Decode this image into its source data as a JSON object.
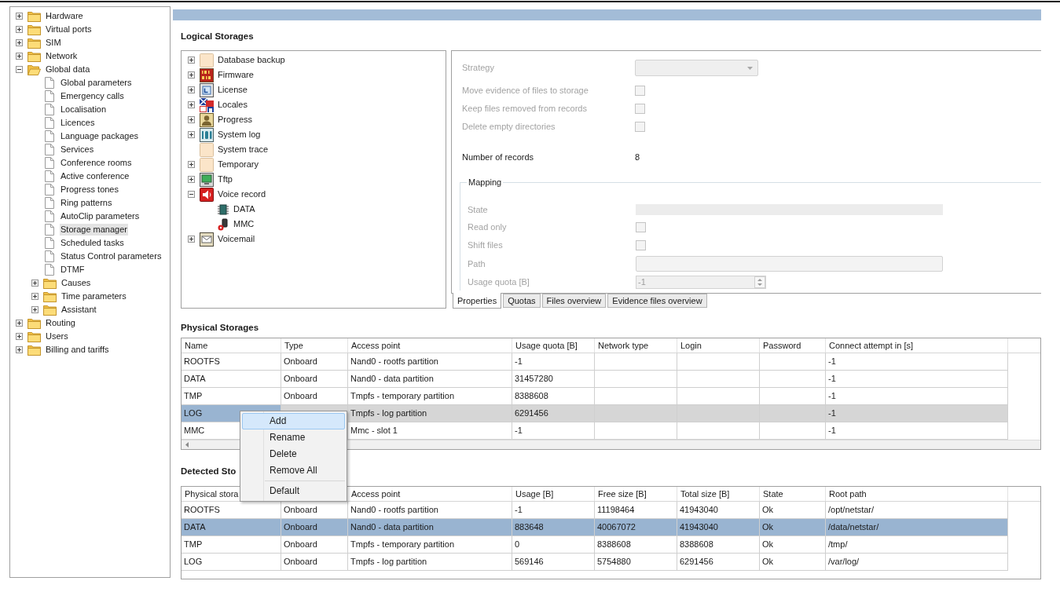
{
  "navigation_tree": {
    "items": [
      {
        "label": "Hardware",
        "kind": "folder",
        "expanded": false,
        "selected": false
      },
      {
        "label": "Virtual ports",
        "kind": "folder",
        "expanded": false,
        "selected": false
      },
      {
        "label": "SIM",
        "kind": "folder",
        "expanded": false,
        "selected": false
      },
      {
        "label": "Network",
        "kind": "folder",
        "expanded": false,
        "selected": false
      },
      {
        "label": "Global data",
        "kind": "folder",
        "expanded": true,
        "selected": false,
        "children": [
          {
            "label": "Global parameters",
            "kind": "page",
            "selected": false
          },
          {
            "label": "Emergency calls",
            "kind": "page",
            "selected": false
          },
          {
            "label": "Localisation",
            "kind": "page",
            "selected": false
          },
          {
            "label": "Licences",
            "kind": "page",
            "selected": false
          },
          {
            "label": "Language packages",
            "kind": "page",
            "selected": false
          },
          {
            "label": "Services",
            "kind": "page",
            "selected": false
          },
          {
            "label": "Conference rooms",
            "kind": "page",
            "selected": false
          },
          {
            "label": "Active conference",
            "kind": "page",
            "selected": false
          },
          {
            "label": "Progress tones",
            "kind": "page",
            "selected": false
          },
          {
            "label": "Ring patterns",
            "kind": "page",
            "selected": false
          },
          {
            "label": "AutoClip parameters",
            "kind": "page",
            "selected": false
          },
          {
            "label": "Storage manager",
            "kind": "page",
            "selected": true
          },
          {
            "label": "Scheduled tasks",
            "kind": "page",
            "selected": false
          },
          {
            "label": "Status Control parameters",
            "kind": "page",
            "selected": false
          },
          {
            "label": "DTMF",
            "kind": "page",
            "selected": false
          },
          {
            "label": "Causes",
            "kind": "folder",
            "expanded": false,
            "selected": false
          },
          {
            "label": "Time parameters",
            "kind": "folder",
            "expanded": false,
            "selected": false
          },
          {
            "label": "Assistant",
            "kind": "folder",
            "expanded": false,
            "selected": false
          }
        ]
      },
      {
        "label": "Routing",
        "kind": "folder",
        "expanded": false,
        "selected": false
      },
      {
        "label": "Users",
        "kind": "folder",
        "expanded": false,
        "selected": false
      },
      {
        "label": "Billing and tariffs",
        "kind": "folder",
        "expanded": false,
        "selected": false
      }
    ]
  },
  "logical_storages": {
    "title": "Logical Storages",
    "tree": [
      {
        "label": "Database backup",
        "kind": "blank",
        "expanded": false
      },
      {
        "label": "Firmware",
        "kind": "binary",
        "expanded": false
      },
      {
        "label": "License",
        "kind": "certificate",
        "expanded": false
      },
      {
        "label": "Locales",
        "kind": "flags",
        "expanded": false
      },
      {
        "label": "Progress",
        "kind": "person",
        "expanded": false
      },
      {
        "label": "System log",
        "kind": "log",
        "expanded": false
      },
      {
        "label": "System trace",
        "kind": "blank"
      },
      {
        "label": "Temporary",
        "kind": "blank",
        "expanded": false
      },
      {
        "label": "Tftp",
        "kind": "monitor",
        "expanded": false
      },
      {
        "label": "Voice record",
        "kind": "speaker",
        "expanded": true,
        "children": [
          {
            "label": "DATA",
            "kind": "chip"
          },
          {
            "label": "MMC",
            "kind": "card"
          }
        ]
      },
      {
        "label": "Voicemail",
        "kind": "envelope",
        "expanded": false
      }
    ]
  },
  "properties_panel": {
    "fields": [
      {
        "kind": "dropdown",
        "label": "Strategy",
        "disabled": true
      },
      {
        "kind": "checkbox",
        "label": "Move evidence of files to storage",
        "checked": false,
        "disabled": true
      },
      {
        "kind": "checkbox",
        "label": "Keep files removed from records",
        "checked": false,
        "disabled": true
      },
      {
        "kind": "checkbox",
        "label": "Delete empty directories",
        "checked": false,
        "disabled": true
      },
      {
        "kind": "value",
        "label": "Number of records",
        "value": "8",
        "disabled": false
      }
    ],
    "mapping": {
      "title": "Mapping",
      "fields": [
        {
          "kind": "display",
          "label": "State",
          "disabled": true
        },
        {
          "kind": "checkbox",
          "label": "Read only",
          "checked": false,
          "disabled": true
        },
        {
          "kind": "checkbox",
          "label": "Shift files",
          "checked": false,
          "disabled": true
        },
        {
          "kind": "text",
          "label": "Path",
          "disabled": true
        },
        {
          "kind": "spinner",
          "label": "Usage quota [B]",
          "value": "-1",
          "disabled": true
        }
      ]
    },
    "tabs": [
      {
        "label": "Properties",
        "selected": true
      },
      {
        "label": "Quotas",
        "selected": false
      },
      {
        "label": "Files overview",
        "selected": false
      },
      {
        "label": "Evidence files overview",
        "selected": false
      }
    ]
  },
  "physical_storages": {
    "title": "Physical Storages",
    "full_row_highlight": false,
    "columns": {
      "name": "Name",
      "type": "Type",
      "access_point": "Access point",
      "usage_quota": "Usage quota [B]",
      "network_type": "Network type",
      "login": "Login",
      "password": "Password",
      "connect_attempt": "Connect attempt in [s]"
    },
    "rows": [
      {
        "name": "ROOTFS",
        "type": "Onboard",
        "access_point": "Nand0 - rootfs partition",
        "usage_quota": "-1",
        "connect_attempt": "-1",
        "selected": false
      },
      {
        "name": "DATA",
        "type": "Onboard",
        "access_point": "Nand0 - data partition",
        "usage_quota": "31457280",
        "connect_attempt": "-1",
        "selected": false
      },
      {
        "name": "TMP",
        "type": "Onboard",
        "access_point": "Tmpfs - temporary partition",
        "usage_quota": "8388608",
        "connect_attempt": "-1",
        "selected": false
      },
      {
        "name": "LOG",
        "access_point": "Tmpfs - log partition",
        "usage_quota": "6291456",
        "connect_attempt": "-1",
        "selected": true
      },
      {
        "name": "MMC",
        "access_point": "Mmc - slot 1",
        "usage_quota": "-1",
        "connect_attempt": "-1",
        "selected": false
      }
    ]
  },
  "context_menu": {
    "items": [
      {
        "kind": "item",
        "label": "Add",
        "selected": true
      },
      {
        "kind": "item",
        "label": "Rename",
        "selected": false
      },
      {
        "kind": "item",
        "label": "Delete",
        "selected": false
      },
      {
        "kind": "item",
        "label": "Remove All",
        "selected": false
      },
      {
        "kind": "separator"
      },
      {
        "kind": "item",
        "label": "Default",
        "selected": false
      }
    ]
  },
  "detected_storages": {
    "title": "Detected Sto",
    "full_row_highlight": true,
    "columns": {
      "physical_storage": "Physical stora",
      "access_point": "Access point",
      "usage": "Usage [B]",
      "free_size": "Free size [B]",
      "total_size": "Total size [B]",
      "state": "State",
      "root_path": "Root path"
    },
    "rows": [
      {
        "physical_storage": "ROOTFS",
        "type": "Onboard",
        "access_point": "Nand0 - rootfs partition",
        "usage": "-1",
        "free_size": "11198464",
        "total_size": "41943040",
        "state": "Ok",
        "root_path": "/opt/netstar/",
        "selected": false
      },
      {
        "physical_storage": "DATA",
        "type": "Onboard",
        "access_point": "Nand0 - data partition",
        "usage": "883648",
        "free_size": "40067072",
        "total_size": "41943040",
        "state": "Ok",
        "root_path": "/data/netstar/",
        "selected": true
      },
      {
        "physical_storage": "TMP",
        "type": "Onboard",
        "access_point": "Tmpfs - temporary partition",
        "usage": "0",
        "free_size": "8388608",
        "total_size": "8388608",
        "state": "Ok",
        "root_path": "/tmp/",
        "selected": false
      },
      {
        "physical_storage": "LOG",
        "type": "Onboard",
        "access_point": "Tmpfs - log partition",
        "usage": "569146",
        "free_size": "5754880",
        "total_size": "6291456",
        "state": "Ok",
        "root_path": "/var/log/",
        "selected": false
      }
    ]
  }
}
